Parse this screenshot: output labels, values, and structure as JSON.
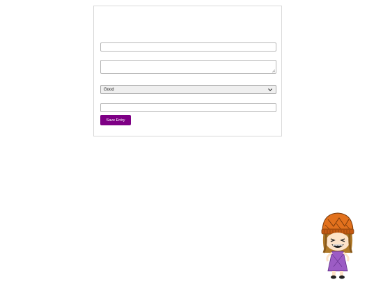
{
  "form": {
    "field1": {
      "value": "",
      "placeholder": ""
    },
    "notes": {
      "value": "",
      "placeholder": ""
    },
    "rating": {
      "selected": "Good"
    },
    "field2": {
      "value": "",
      "placeholder": ""
    },
    "save_label": "Save Entry"
  },
  "colors": {
    "accent": "#7e0085",
    "mascot_hat": "#e2711d",
    "mascot_dress": "#9c5cc4"
  },
  "mascot": {
    "icon": "mascot-character-icon"
  }
}
